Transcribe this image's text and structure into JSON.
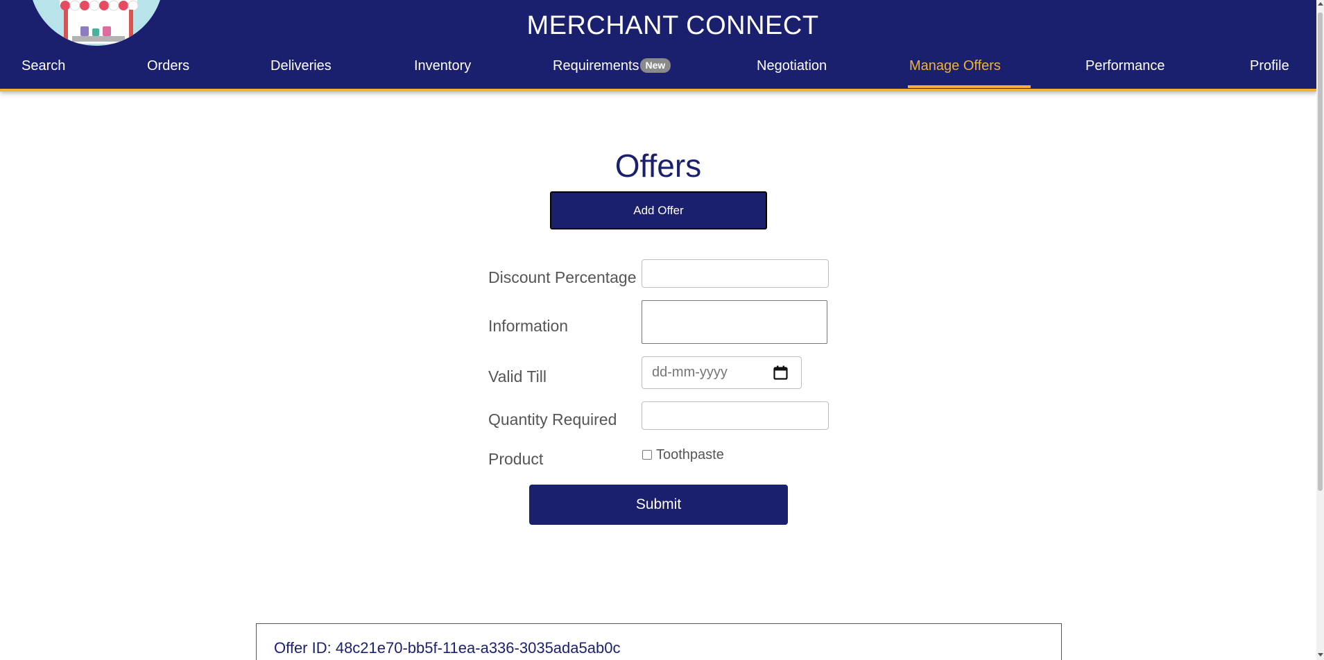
{
  "app": {
    "title": "MERCHANT CONNECT"
  },
  "nav": {
    "items": [
      {
        "label": "Search"
      },
      {
        "label": "Orders"
      },
      {
        "label": "Deliveries"
      },
      {
        "label": "Inventory"
      },
      {
        "label": "Requirements",
        "badge": "New"
      },
      {
        "label": "Negotiation"
      },
      {
        "label": "Manage Offers",
        "active": true
      },
      {
        "label": "Performance"
      },
      {
        "label": "Profile"
      }
    ]
  },
  "main": {
    "title": "Offers",
    "add_offer_label": "Add Offer"
  },
  "form": {
    "discount": {
      "label": "Discount Percentage",
      "value": ""
    },
    "information": {
      "label": "Information",
      "value": ""
    },
    "valid_till": {
      "label": "Valid Till",
      "placeholder": "dd-mm-yyyy"
    },
    "quantity": {
      "label": "Quantity Required",
      "value": ""
    },
    "product": {
      "label": "Product",
      "options": [
        {
          "label": "Toothpaste",
          "checked": false
        }
      ]
    },
    "submit_label": "Submit"
  },
  "offers": [
    {
      "id_text": "Offer ID: 48c21e70-bb5f-11ea-a336-3035ada5ab0c"
    }
  ],
  "colors": {
    "primary": "#1a1f6e",
    "accent": "#f2b233",
    "label": "#555555"
  },
  "icons": {
    "logo": "market-stall-logo",
    "calendar": "calendar-icon"
  }
}
